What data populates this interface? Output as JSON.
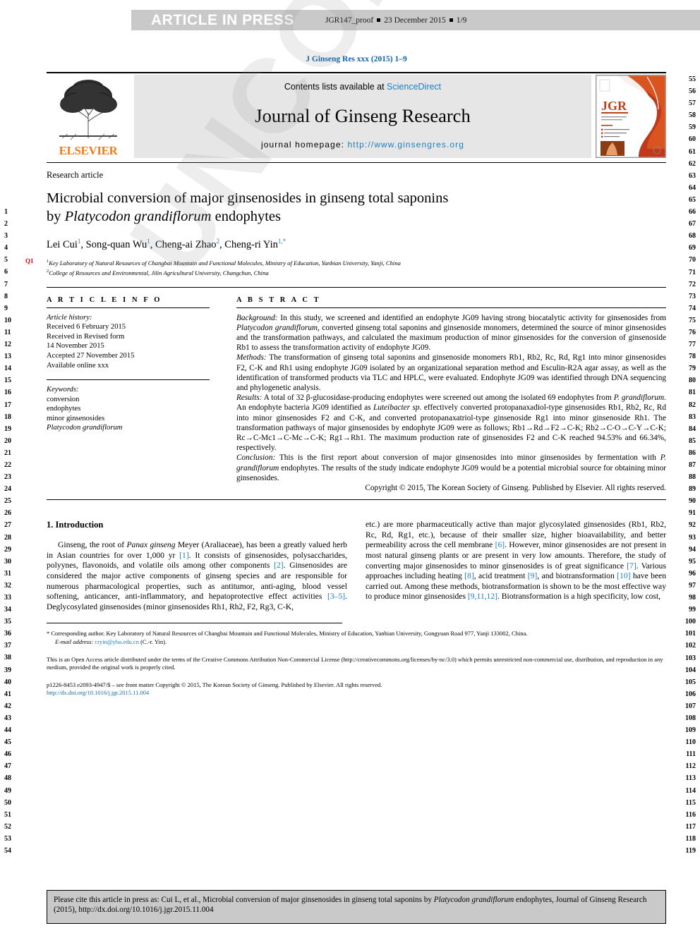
{
  "proof_bar": {
    "article_in_press": "ARTICLE IN PRESS",
    "proof_id": "JGR147_proof",
    "proof_date": "23 December 2015",
    "proof_page": "1/9"
  },
  "watermark_text": "UNCORRECTED PROOF",
  "journal_header": {
    "citation_line": "J Ginseng Res xxx (2015) 1–9",
    "contents_prefix": "Contents lists available at ",
    "sciencedirect": "ScienceDirect",
    "journal_name": "Journal of Ginseng Research",
    "homepage_label": "journal homepage: ",
    "homepage_url": "http://www.ginsengres.org",
    "publisher_wordmark": "ELSEVIER",
    "cover_badge": "JGR"
  },
  "article": {
    "type_label": "Research article",
    "title_line1": "Microbial conversion of major ginsenosides in ginseng total saponins",
    "title_line2_prefix": "by ",
    "title_line2_italic": "Platycodon grandiflorum",
    "title_line2_suffix": " endophytes",
    "authors": [
      {
        "name": "Lei Cui",
        "sup": "1",
        "sep": ", "
      },
      {
        "name": "Song-quan Wu",
        "sup": "1",
        "sep": ", "
      },
      {
        "name": "Cheng-ai Zhao",
        "sup": "2",
        "sep": ", "
      },
      {
        "name": "Cheng-ri Yin",
        "sup": "1,*",
        "sep": ""
      }
    ],
    "affiliations": [
      {
        "marker": "1",
        "text": "Key Laboratory of Natural Resources of Changbai Mountain and Functional Molecules, Ministry of Education, Yanbian University, Yanji, China"
      },
      {
        "marker": "2",
        "text": "College of Resources and Environmental, Jilin Agricultural University, Changchun, China"
      }
    ],
    "query_marker": "Q1"
  },
  "article_info": {
    "heading": "A R T I C L E   I N F O",
    "history_label": "Article history:",
    "history": [
      "Received 6 February 2015",
      "Received in Revised form",
      "14 November 2015",
      "Accepted 27 November 2015",
      "Available online xxx"
    ],
    "keywords_label": "Keywords:",
    "keywords": [
      "conversion",
      "endophytes",
      "minor ginsenosides",
      "Platycodon grandiflorum"
    ]
  },
  "abstract": {
    "heading": "A B S T R A C T",
    "background_label": "Background:",
    "background_text": " In this study, we screened and identified an endophyte JG09 having strong biocatalytic activity for ginsenosides from Platycodon grandiflorum, converted ginseng total saponins and ginsenoside monomers, determined the source of minor ginsenosides and the transformation pathways, and calculated the maximum production of minor ginsenosides for the conversion of ginsenoside Rb1 to assess the transformation activity of endophyte JG09.",
    "methods_label": "Methods:",
    "methods_text": " The transformation of ginseng total saponins and ginsenoside monomers Rb1, Rb2, Rc, Rd, Rg1 into minor ginsenosides F2, C-K and Rh1 using endophyte JG09 isolated by an organizational separation method and Esculin-R2A agar assay, as well as the identification of transformed products via TLC and HPLC, were evaluated. Endophyte JG09 was identified through DNA sequencing and phylogenetic analysis.",
    "results_label": "Results:",
    "results_text": " A total of 32 β-glucosidase-producing endophytes were screened out among the isolated 69 endophytes from P. grandiflorum. An endophyte bacteria JG09 identified as Luteibacter sp. effectively converted protopanaxadiol-type ginsenosides Rb1, Rb2, Rc, Rd into minor ginsenosides F2 and C-K, and converted protopanaxatriol-type ginsenoside Rg1 into minor ginsenoside Rh1. The transformation pathways of major ginsenosides by endophyte JG09 were as follows; Rb1→Rd→F2→C-K; Rb2→C-O→C-Y→C-K; Rc→C-Mc1→C-Mc→C-K; Rg1→Rh1. The maximum production rate of ginsenosides F2 and C-K reached 94.53% and 66.34%, respectively.",
    "conclusion_label": "Conclusion:",
    "conclusion_text": " This is the first report about conversion of major ginsenosides into minor ginsenosides by fermentation with P. grandiflorum endophytes. The results of the study indicate endophyte JG09 would be a potential microbial source for obtaining minor ginsenosides.",
    "copyright": "Copyright © 2015, The Korean Society of Ginseng. Published by Elsevier. All rights reserved."
  },
  "introduction": {
    "heading": "1. Introduction",
    "left_column": "Ginseng, the root of Panax ginseng Meyer (Araliaceae), has been a greatly valued herb in Asian countries for over 1,000 yr [1]. It consists of ginsenosides, polysaccharides, polyynes, flavonoids, and volatile oils among other components [2]. Ginsenosides are considered the major active components of ginseng species and are responsible for numerous pharmacological properties, such as antitumor, anti-aging, blood vessel softening, anticancer, anti-inflammatory, and hepatoprotective effect activities [3–5]. Deglycosylated ginsenosides (minor ginsenosides Rh1, Rh2, F2, Rg3, C-K,",
    "right_column": "etc.) are more pharmaceutically active than major glycosylated ginsenosides (Rb1, Rb2, Rc, Rd, Rg1, etc.), because of their smaller size, higher bioavailability, and better permeability across the cell membrane [6]. However, minor ginsenosides are not present in most natural ginseng plants or are present in very low amounts. Therefore, the study of converting major ginsenosides to minor ginsenosides is of great significance [7]. Various approaches including heating [8], acid treatment [9], and biotransformation [10] have been carried out. Among these methods, biotransformation is shown to be the most effective way to produce minor ginsenosides [9,11,12]. Biotransformation is a high specificity, low cost,"
  },
  "footnotes": {
    "corresponding": "* Corresponding author. Key Laboratory of Natural Resources of Changbai Mountain and Functional Molecules, Ministry of Education, Yanbian University, Gongyuan Road 977, Yanji 133002, China.",
    "email_label": "E-mail address:",
    "email": "cryin@ybu.edu.cn",
    "email_attrib": "(C.-r. Yin).",
    "open_access": "This is an Open Access article distributed under the terms of the Creative Commons Attribution Non-Commercial License (http://creativecommons.org/licenses/by-nc/3.0) which permits unrestricted non-commercial use, distribution, and reproduction in any medium, provided the original work is properly cited.",
    "open_access_url": "http://creativecommons.org/licenses/by-nc/3.0",
    "issn_line": "p1226-8453 e2093-4947/$ – see front matter Copyright © 2015, The Korean Society of Ginseng. Published by Elsevier. All rights reserved.",
    "doi_url": "http://dx.doi.org/10.1016/j.jgr.2015.11.004"
  },
  "cite_box": {
    "prefix": "Please cite this article in press as: Cui L, et al., Microbial conversion of major ginsenosides in ginseng total saponins by ",
    "italic": "Platycodon grandiflorum",
    "suffix": " endophytes, Journal of Ginseng Research (2015), http://dx.doi.org/10.1016/j.jgr.2015.11.004"
  },
  "line_numbers": {
    "left_start": 1,
    "left_end": 54,
    "right_start": 55,
    "right_end": 119
  },
  "colors": {
    "link_blue": "#1a7fc1",
    "elsevier_orange": "#f07c1b",
    "query_red": "#e8000b",
    "bar_gray": "#c9c9c9",
    "contents_gray": "#e6e6e6"
  }
}
